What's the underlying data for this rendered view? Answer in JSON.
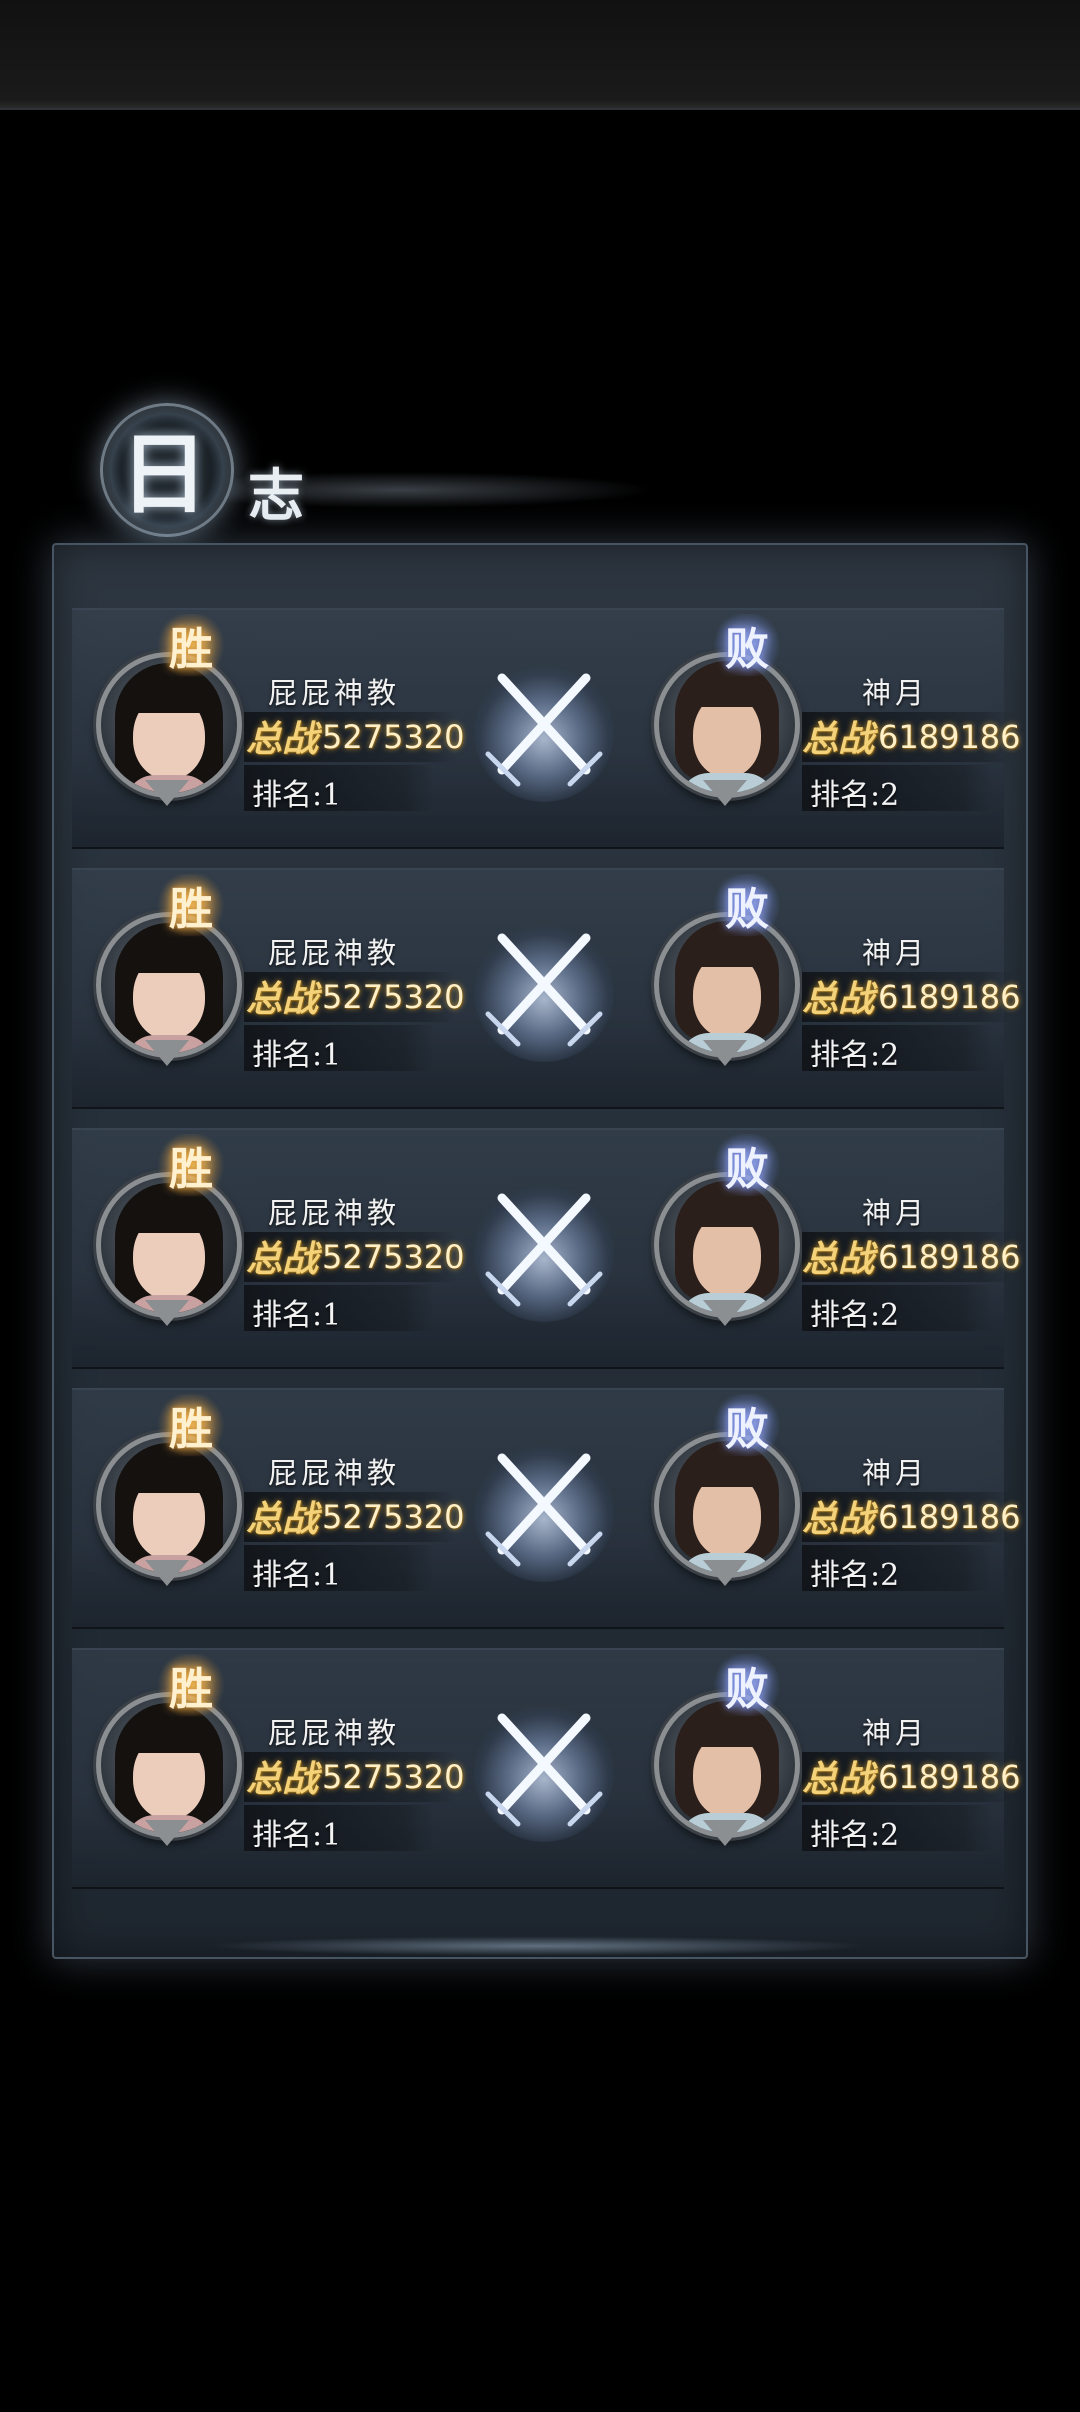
{
  "log": {
    "title_char_1": "日",
    "title_char_2": "志"
  },
  "battles": [
    {
      "left": {
        "result": "胜",
        "name": "屁屁神教",
        "power_label": "总战",
        "power": "5275320",
        "rank": "排名:1"
      },
      "right": {
        "result": "败",
        "name": "神月",
        "power_label": "总战",
        "power": "6189186",
        "rank": "排名:2"
      }
    },
    {
      "left": {
        "result": "胜",
        "name": "屁屁神教",
        "power_label": "总战",
        "power": "5275320",
        "rank": "排名:1"
      },
      "right": {
        "result": "败",
        "name": "神月",
        "power_label": "总战",
        "power": "6189186",
        "rank": "排名:2"
      }
    },
    {
      "left": {
        "result": "胜",
        "name": "屁屁神教",
        "power_label": "总战",
        "power": "5275320",
        "rank": "排名:1"
      },
      "right": {
        "result": "败",
        "name": "神月",
        "power_label": "总战",
        "power": "6189186",
        "rank": "排名:2"
      }
    },
    {
      "left": {
        "result": "胜",
        "name": "屁屁神教",
        "power_label": "总战",
        "power": "5275320",
        "rank": "排名:1"
      },
      "right": {
        "result": "败",
        "name": "神月",
        "power_label": "总战",
        "power": "6189186",
        "rank": "排名:2"
      }
    },
    {
      "left": {
        "result": "胜",
        "name": "屁屁神教",
        "power_label": "总战",
        "power": "5275320",
        "rank": "排名:1"
      },
      "right": {
        "result": "败",
        "name": "神月",
        "power_label": "总战",
        "power": "6189186",
        "rank": "排名:2"
      }
    }
  ],
  "icons": {
    "vs": "crossed-swords-icon",
    "winner_avatar": "female-avatar",
    "loser_avatar": "male-avatar"
  },
  "colors": {
    "win_glow": "#f5be64",
    "lose_glow": "#96aaf0",
    "power_text": "#f4d27a",
    "panel": "#26303a"
  }
}
